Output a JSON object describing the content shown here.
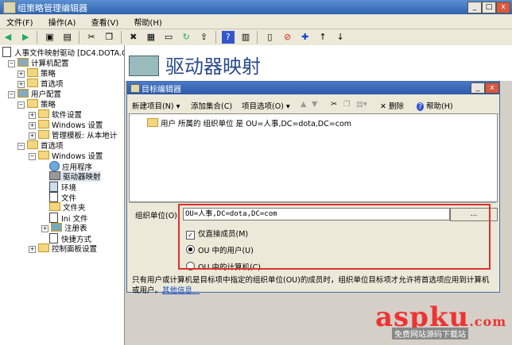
{
  "window": {
    "title": "组策略管理编辑器",
    "min": "_",
    "max": "□",
    "close": "x"
  },
  "menu": [
    "文件(F)",
    "操作(A)",
    "查看(V)",
    "帮助(H)"
  ],
  "tree": {
    "root": "人事文件映射驱动 [DC4.DOTA.C",
    "items": [
      {
        "label": "计算机配置",
        "level": 0
      },
      {
        "label": "策略",
        "level": 1
      },
      {
        "label": "首选项",
        "level": 1
      },
      {
        "label": "用户配置",
        "level": 0
      },
      {
        "label": "策略",
        "level": 1
      },
      {
        "label": "软件设置",
        "level": 2
      },
      {
        "label": "Windows 设置",
        "level": 2
      },
      {
        "label": "管理模板: 从本地计",
        "level": 2
      },
      {
        "label": "首选项",
        "level": 1
      },
      {
        "label": "Windows 设置",
        "level": 2
      },
      {
        "label": "应用程序",
        "level": 3
      },
      {
        "label": "驱动器映射",
        "level": 3
      },
      {
        "label": "环境",
        "level": 3
      },
      {
        "label": "文件",
        "level": 3
      },
      {
        "label": "文件夹",
        "level": 3
      },
      {
        "label": "Ini 文件",
        "level": 3
      },
      {
        "label": "注册表",
        "level": 3
      },
      {
        "label": "快捷方式",
        "level": 3
      },
      {
        "label": "控制面板设置",
        "level": 2
      }
    ]
  },
  "banner": {
    "title": "驱动器映射"
  },
  "dialog": {
    "title": "目标编辑器",
    "toolbar": {
      "new_item": "新建项目(N)",
      "add_collection": "添加集合(C)",
      "item_options": "项目选项(O)",
      "delete": "删除",
      "help": "帮助(H)"
    },
    "list_item": "用户 所属的 组织单位 是 OU=人事,DC=dota,DC=com",
    "ou_label": "组织单位(O)",
    "ou_value": "OU=人事,DC=dota,DC=com",
    "browse": "...",
    "direct_members": "仅直接成员(M)",
    "user_in_ou": "OU 中的用户(U)",
    "computer_in_ou": "OU 中的计算机(C)",
    "description": "只有用户或计算机是目标项中指定的组织单位(OU)的成员时，组织单位目标项才允许将首选项应用到计算机或用户。",
    "more_info": "其他信息..."
  },
  "watermark": {
    "brand": "aspku",
    "suffix": ".com",
    "tagline": "免费网站源码下载站"
  }
}
